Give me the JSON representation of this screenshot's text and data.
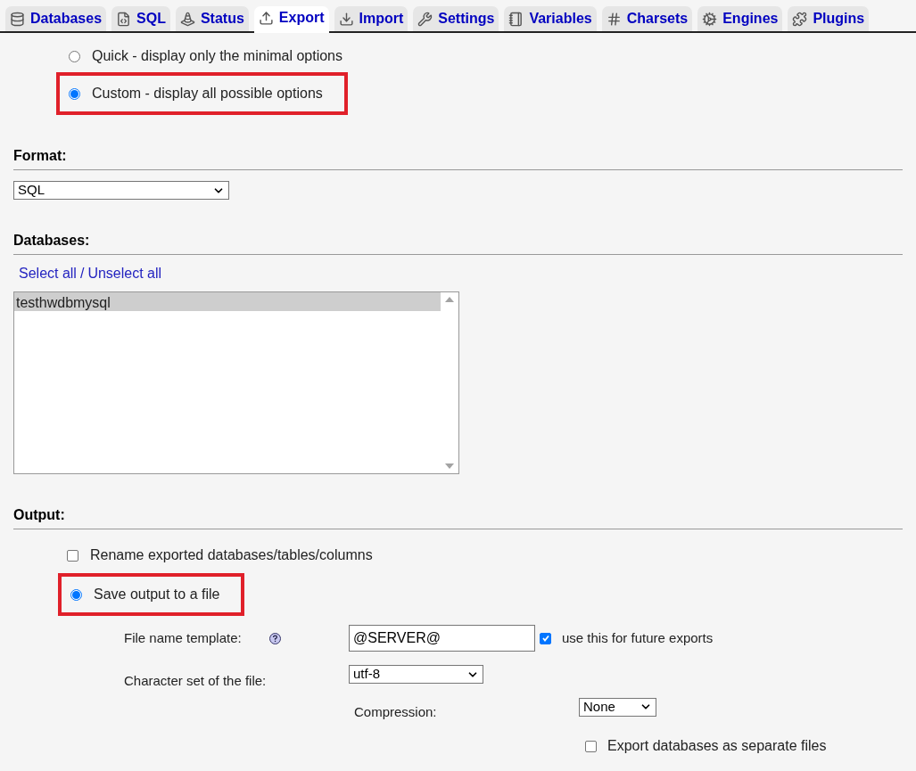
{
  "tabs": [
    {
      "label": "Databases",
      "selected": false
    },
    {
      "label": "SQL",
      "selected": false
    },
    {
      "label": "Status",
      "selected": false
    },
    {
      "label": "Export",
      "selected": true
    },
    {
      "label": "Import",
      "selected": false
    },
    {
      "label": "Settings",
      "selected": false
    },
    {
      "label": "Variables",
      "selected": false
    },
    {
      "label": "Charsets",
      "selected": false
    },
    {
      "label": "Engines",
      "selected": false
    },
    {
      "label": "Plugins",
      "selected": false
    }
  ],
  "export_method": [
    {
      "label": "Quick - display only the minimal options",
      "selected": false,
      "highlighted": false
    },
    {
      "label": "Custom - display all possible options",
      "selected": true,
      "highlighted": true
    }
  ],
  "format": {
    "heading": "Format:",
    "value": "SQL"
  },
  "databases": {
    "heading": "Databases:",
    "select_all": "Select all",
    "separator": "/",
    "unselect_all": "Unselect all",
    "items": [
      {
        "label": "testhwdbmysql",
        "selected": true
      }
    ]
  },
  "output": {
    "heading": "Output:",
    "rename": {
      "label": "Rename exported databases/tables/columns",
      "checked": false
    },
    "save_to_file": {
      "label": "Save output to a file",
      "selected": true,
      "highlighted": true
    },
    "file_name_template": {
      "label": "File name template:",
      "value": "@SERVER@",
      "remember": {
        "label": "use this for future exports",
        "checked": true
      }
    },
    "charset": {
      "label": "Character set of the file:",
      "value": "utf-8"
    },
    "compression": {
      "label": "Compression:",
      "value": "None"
    },
    "separate_files": {
      "label": "Export databases as separate files",
      "checked": false
    }
  }
}
